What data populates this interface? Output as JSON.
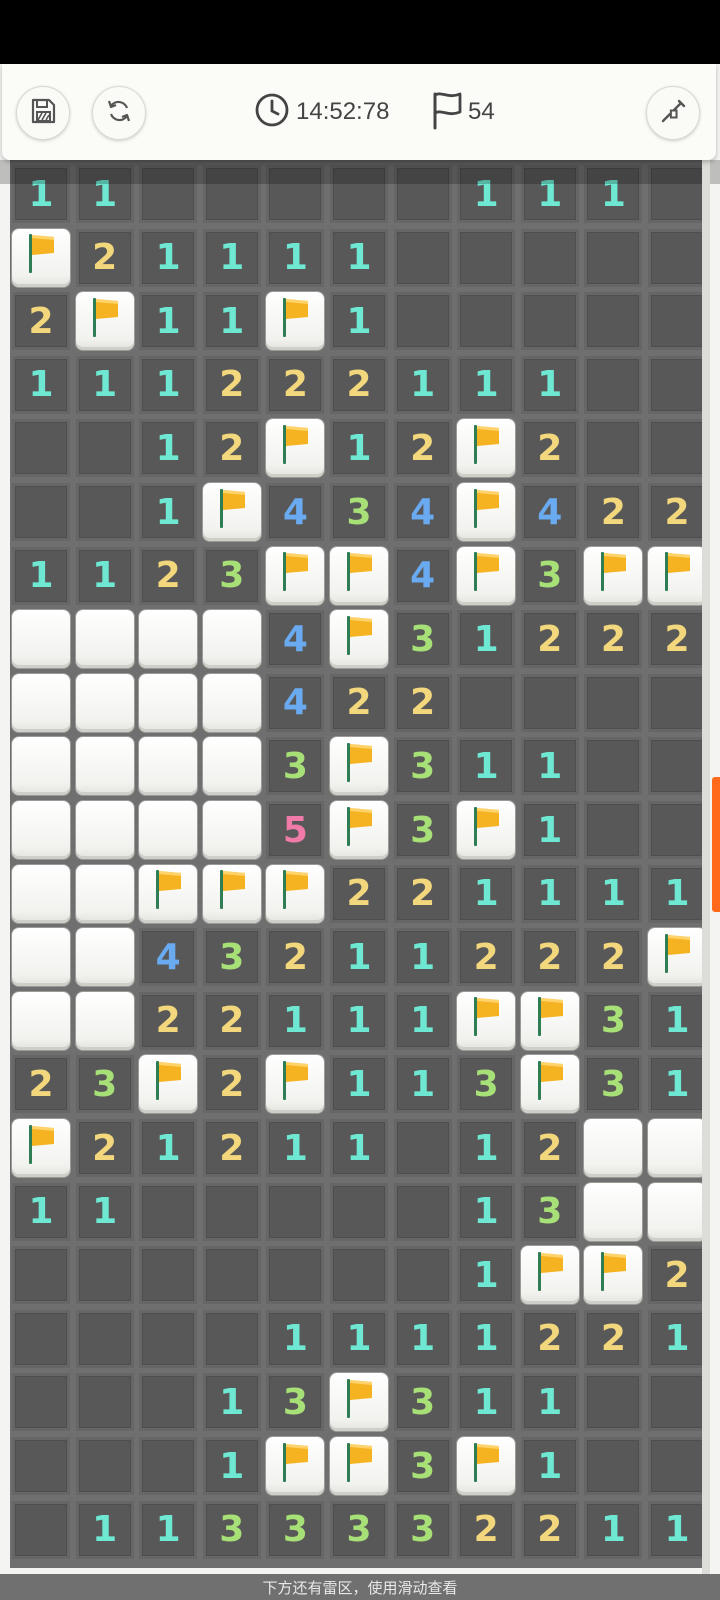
{
  "toolbar": {
    "save_icon": "save-icon",
    "restart_icon": "restart-icon",
    "timer_icon": "clock-icon",
    "timer": "14:52:78",
    "flag_icon": "flag-icon",
    "flag_count": "54",
    "settings_icon": "shovel-icon"
  },
  "colors": {
    "n1": "#6ee8d2",
    "n2": "#f3d77d",
    "n3": "#a8e078",
    "n4": "#6aaaf0",
    "n5": "#f07aa8",
    "flag": "#f5b321",
    "accent": "#ff6a1a"
  },
  "board": {
    "rows": [
      [
        "1",
        "1",
        ".",
        ".",
        ".",
        ".",
        ".",
        "1",
        "1",
        "1",
        "."
      ],
      [
        "F",
        "2",
        "1",
        "1",
        "1",
        "1",
        ".",
        ".",
        ".",
        ".",
        "."
      ],
      [
        "2",
        "F",
        "1",
        "1",
        "F",
        "1",
        ".",
        ".",
        ".",
        ".",
        "."
      ],
      [
        "1",
        "1",
        "1",
        "2",
        "2",
        "2",
        "1",
        "1",
        "1",
        ".",
        "."
      ],
      [
        ".",
        ".",
        "1",
        "2",
        "F",
        "1",
        "2",
        "F",
        "2",
        ".",
        "."
      ],
      [
        ".",
        ".",
        "1",
        "F",
        "4",
        "3",
        "4",
        "F",
        "4",
        "2",
        "2"
      ],
      [
        "1",
        "1",
        "2",
        "3",
        "F",
        "F",
        "4",
        "F",
        "3",
        "F",
        "F"
      ],
      [
        "#",
        "#",
        "#",
        "#",
        "4",
        "F",
        "3",
        "1",
        "2",
        "2",
        "2"
      ],
      [
        "#",
        "#",
        "#",
        "#",
        "4",
        "2",
        "2",
        ".",
        ".",
        ".",
        "."
      ],
      [
        "#",
        "#",
        "#",
        "#",
        "3",
        "F",
        "3",
        "1",
        "1",
        ".",
        "."
      ],
      [
        "#",
        "#",
        "#",
        "#",
        "5",
        "F",
        "3",
        "F",
        "1",
        ".",
        "."
      ],
      [
        "#",
        "#",
        "F",
        "F",
        "F",
        "2",
        "2",
        "1",
        "1",
        "1",
        "1"
      ],
      [
        "#",
        "#",
        "4",
        "3",
        "2",
        "1",
        "1",
        "2",
        "2",
        "2",
        "F"
      ],
      [
        "#",
        "#",
        "2",
        "2",
        "1",
        "1",
        "1",
        "F",
        "F",
        "3",
        "1"
      ],
      [
        "2",
        "3",
        "F",
        "2",
        "F",
        "1",
        "1",
        "3",
        "F",
        "3",
        "1"
      ],
      [
        "F",
        "2",
        "1",
        "2",
        "1",
        "1",
        ".",
        "1",
        "2",
        "#",
        "#"
      ],
      [
        "1",
        "1",
        ".",
        ".",
        ".",
        ".",
        ".",
        "1",
        "3",
        "#",
        "#"
      ],
      [
        ".",
        ".",
        ".",
        ".",
        ".",
        ".",
        ".",
        "1",
        "F",
        "F",
        "2"
      ],
      [
        ".",
        ".",
        ".",
        ".",
        "1",
        "1",
        "1",
        "1",
        "2",
        "2",
        "1"
      ],
      [
        ".",
        ".",
        ".",
        "1",
        "3",
        "F",
        "3",
        "1",
        "1",
        ".",
        "."
      ],
      [
        ".",
        ".",
        ".",
        "1",
        "F",
        "F",
        "3",
        "F",
        "1",
        ".",
        "."
      ],
      [
        ".",
        "1",
        "1",
        "3",
        "3",
        "3",
        "3",
        "2",
        "2",
        "1",
        "1"
      ]
    ]
  },
  "footer": {
    "hint": "下方还有雷区，使用滑动查看"
  }
}
